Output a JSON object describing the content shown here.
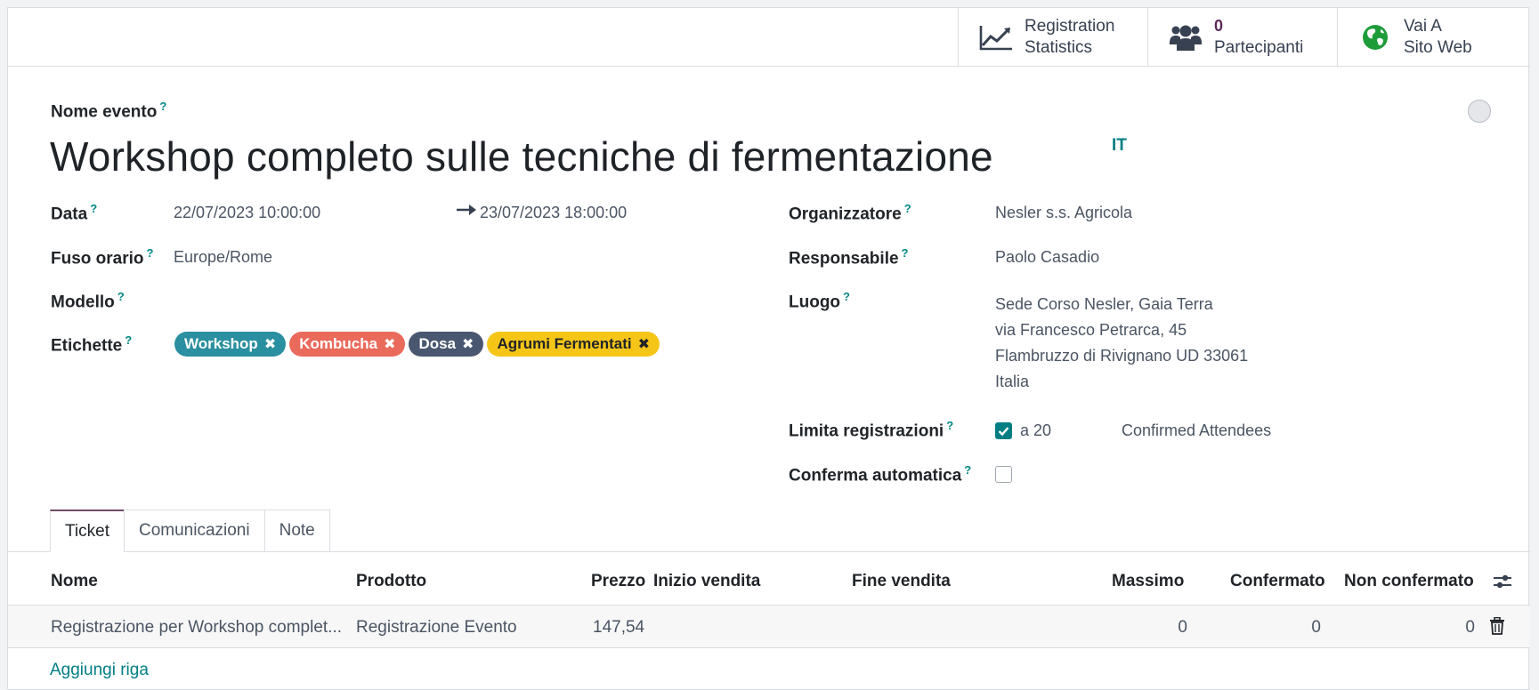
{
  "buttons": {
    "stats": {
      "line1": "Registration",
      "line2": "Statistics"
    },
    "attendees": {
      "count": "0",
      "label": "Partecipanti"
    },
    "website": {
      "line1": "Vai A",
      "line2": "Sito Web"
    }
  },
  "form": {
    "name_label": "Nome evento",
    "name_value": "Workshop completo sulle tecniche di fermentazione",
    "lang": "IT",
    "date_label": "Data",
    "date_start": "22/07/2023 10:00:00",
    "date_end": "23/07/2023 18:00:00",
    "tz_label": "Fuso orario",
    "tz_value": "Europe/Rome",
    "template_label": "Modello",
    "tags_label": "Etichette",
    "tags": [
      {
        "name": "Workshop",
        "color": "#2a8fa0"
      },
      {
        "name": "Kombucha",
        "color": "#ea6a5c"
      },
      {
        "name": "Dosa",
        "color": "#4a5770"
      },
      {
        "name": "Agrumi Fermentati",
        "color": "#f5c518"
      }
    ],
    "organizer_label": "Organizzatore",
    "organizer_value": "Nesler s.s. Agricola",
    "responsible_label": "Responsabile",
    "responsible_value": "Paolo Casadio",
    "venue_label": "Luogo",
    "venue_lines": [
      "Sede Corso Nesler, Gaia Terra",
      "via Francesco Petrarca, 45",
      "Flambruzzo di Rivignano UD 33061",
      "Italia"
    ],
    "limit_label": "Limita registrazioni",
    "limit_prefix": "a 20",
    "limit_suffix": "Confirmed Attendees",
    "autoconfirm_label": "Conferma automatica",
    "help_mark": "?"
  },
  "tabs": [
    "Ticket",
    "Comunicazioni",
    "Note"
  ],
  "table": {
    "headers": [
      "Nome",
      "Prodotto",
      "Prezzo",
      "Inizio vendita",
      "Fine vendita",
      "Massimo",
      "Confermato",
      "Non confermato"
    ],
    "rows": [
      {
        "name": "Registrazione per Workshop complet...",
        "product": "Registrazione Evento",
        "price": "147,54",
        "start": "",
        "end": "",
        "max": "0",
        "confirmed": "0",
        "unconfirmed": "0"
      }
    ],
    "add_line": "Aggiungi riga"
  },
  "colors": {
    "accent": "#017e84",
    "brand": "#714b67"
  }
}
